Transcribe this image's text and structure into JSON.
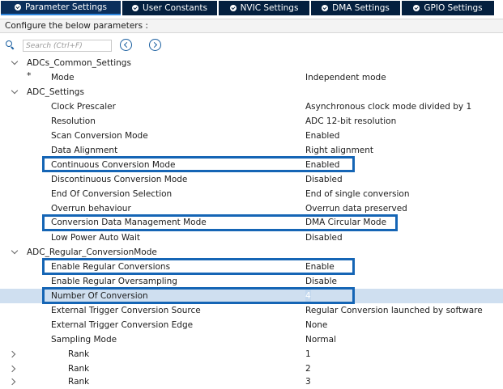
{
  "tabs": [
    {
      "label": "Parameter Settings",
      "active": true
    },
    {
      "label": "User Constants",
      "active": false
    },
    {
      "label": "NVIC Settings",
      "active": false
    },
    {
      "label": "DMA Settings",
      "active": false
    },
    {
      "label": "GPIO Settings",
      "active": false
    }
  ],
  "configure_text": "Configure the below parameters :",
  "search": {
    "placeholder": "Search (Ctrl+F)"
  },
  "groups": {
    "adcs_common": "ADCs_Common_Settings",
    "adc_settings": "ADC_Settings",
    "adc_regular": "ADC_Regular_ConversionMode"
  },
  "params": {
    "mode": {
      "label": "Mode",
      "value": "Independent mode"
    },
    "clock_prescaler": {
      "label": "Clock Prescaler",
      "value": "Asynchronous clock mode divided by 1"
    },
    "resolution": {
      "label": "Resolution",
      "value": "ADC 12-bit resolution"
    },
    "scan_conversion": {
      "label": "Scan Conversion Mode",
      "value": "Enabled"
    },
    "data_alignment": {
      "label": "Data Alignment",
      "value": "Right alignment"
    },
    "continuous_conversion": {
      "label": "Continuous Conversion Mode",
      "value": "Enabled"
    },
    "discontinuous_conversion": {
      "label": "Discontinuous Conversion Mode",
      "value": "Disabled"
    },
    "end_of_conversion": {
      "label": "End Of Conversion Selection",
      "value": "End of single conversion"
    },
    "overrun": {
      "label": "Overrun behaviour",
      "value": "Overrun data preserved"
    },
    "conversion_data_mgmt": {
      "label": "Conversion Data Management Mode",
      "value": "DMA Circular Mode"
    },
    "low_power_auto_wait": {
      "label": "Low Power Auto Wait",
      "value": "Disabled"
    },
    "enable_regular_conversions": {
      "label": "Enable Regular Conversions",
      "value": "Enable"
    },
    "enable_regular_oversampling": {
      "label": "Enable Regular Oversampling",
      "value": "Disable"
    },
    "number_of_conversion": {
      "label": "Number Of Conversion",
      "value": "4"
    },
    "ext_trigger_source": {
      "label": "External Trigger Conversion Source",
      "value": "Regular Conversion launched by software"
    },
    "ext_trigger_edge": {
      "label": "External Trigger Conversion Edge",
      "value": "None"
    },
    "sampling_mode": {
      "label": "Sampling Mode",
      "value": "Normal"
    },
    "rank1": {
      "label": "Rank",
      "value": "1"
    },
    "rank2": {
      "label": "Rank",
      "value": "2"
    },
    "rank3": {
      "label": "Rank",
      "value": "3"
    }
  }
}
